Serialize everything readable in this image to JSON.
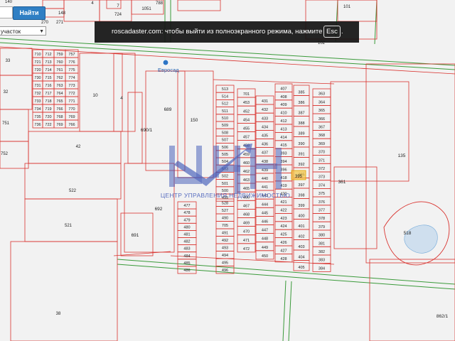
{
  "toolbar": {
    "find_label": "Найти",
    "type_selected": "участок"
  },
  "fullscreen_notice": {
    "message": "roscadaster.com: чтобы выйти из полноэкранного режима, нажмите",
    "key": "Esc",
    "end": "."
  },
  "poi": {
    "label": "Евросад",
    "icon": "map-pin-icon"
  },
  "watermark": {
    "logo_text": "ЦУН",
    "caption": "ЦЕНТР УПРАВЛЕНИЯ НЕДВИЖИМОСТЬЮ"
  },
  "highlight": {
    "parcel": "395",
    "color": "#f4c542"
  },
  "colors": {
    "parcel_line": "#d9322e",
    "road_line": "#3a9a3a",
    "water": "#9bc4e8",
    "map_bg": "#f2f2f2"
  },
  "parcels": {
    "top_strip": [
      "140",
      "148",
      "4",
      "1051",
      "788",
      "724",
      "7",
      "271",
      "270",
      "101",
      "102"
    ],
    "left_column": [
      "33",
      "32",
      "751",
      "752",
      "42",
      "522",
      "521",
      "38"
    ],
    "west_grid": [
      [
        "710",
        "712",
        "759",
        "757"
      ],
      [
        "721",
        "713",
        "760",
        "776"
      ],
      [
        "720",
        "714",
        "761",
        "775"
      ],
      [
        "730",
        "715",
        "762",
        "774"
      ],
      [
        "731",
        "716",
        "763",
        "773"
      ],
      [
        "732",
        "717",
        "764",
        "772"
      ],
      [
        "733",
        "718",
        "765",
        "771"
      ],
      [
        "734",
        "719",
        "766",
        "770"
      ],
      [
        "735",
        "720",
        "768",
        "769"
      ],
      [
        "736",
        "722",
        "769",
        "766"
      ]
    ],
    "center_blocks": [
      "10",
      "4",
      "689",
      "150",
      "690/1",
      "692",
      "691"
    ],
    "col_a": [
      "513",
      "514",
      "512",
      "511",
      "510",
      "509",
      "508",
      "507",
      "506",
      "505",
      "504",
      "503",
      "502",
      "501",
      "500",
      "499"
    ],
    "col_b": [
      "528",
      "527",
      "490",
      "705",
      "491",
      "492",
      "493",
      "494",
      "495",
      "496",
      "497",
      "498"
    ],
    "col_c": [
      "701",
      "453",
      "452",
      "454",
      "455",
      "457",
      "458",
      "459",
      "460",
      "462",
      "463",
      "465",
      "466",
      "467",
      "468",
      "469",
      "470",
      "471",
      "472"
    ],
    "col_d": [
      "431",
      "432",
      "433",
      "434",
      "435",
      "436",
      "437",
      "438",
      "439",
      "440",
      "441",
      "443",
      "444",
      "445",
      "446",
      "447",
      "448",
      "449",
      "450"
    ],
    "col_e": [
      "407",
      "408",
      "409",
      "410",
      "412",
      "413",
      "414",
      "415",
      "393",
      "394",
      "396",
      "418",
      "419",
      "420",
      "421",
      "422",
      "423",
      "424",
      "425",
      "426",
      "427",
      "428"
    ],
    "col_f": [
      "385",
      "386",
      "387",
      "388",
      "389",
      "390",
      "391",
      "392",
      "395",
      "397",
      "398",
      "399",
      "400",
      "401",
      "402",
      "403",
      "404",
      "405",
      "406"
    ],
    "col_g": [
      "363",
      "364",
      "365",
      "366",
      "367",
      "368",
      "369",
      "370",
      "371",
      "372",
      "373",
      "374",
      "375",
      "376",
      "377",
      "378",
      "379",
      "380",
      "381",
      "382",
      "383",
      "384"
    ],
    "left_col_small": [
      "477",
      "478",
      "479",
      "480",
      "481",
      "482",
      "483",
      "484",
      "485",
      "486",
      "487",
      "488",
      "489"
    ],
    "large_east": [
      "135",
      "361",
      "518",
      "862/1"
    ]
  }
}
